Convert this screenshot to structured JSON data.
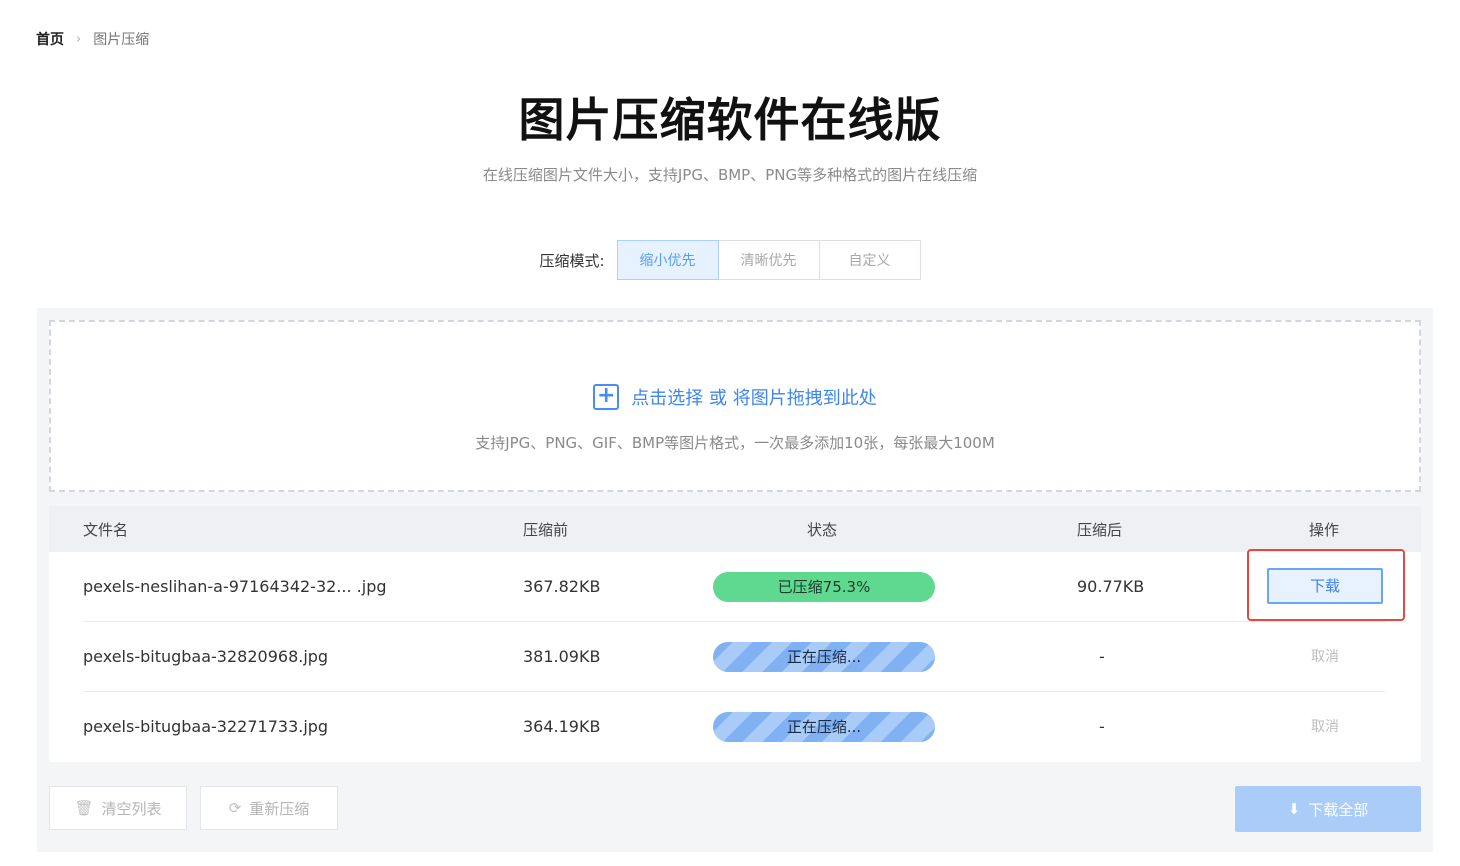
{
  "breadcrumb": {
    "home": "首页",
    "separator": "›",
    "current": "图片压缩"
  },
  "header": {
    "title": "图片压缩软件在线版",
    "subtitle": "在线压缩图片文件大小，支持JPG、BMP、PNG等多种格式的图片在线压缩"
  },
  "mode": {
    "label": "压缩模式:",
    "options": [
      "缩小优先",
      "清晰优先",
      "自定义"
    ],
    "selected": "缩小优先"
  },
  "upload": {
    "icon": "plus-icon",
    "action_text": "点击选择 或 将图片拖拽到此处",
    "hint": "支持JPG、PNG、GIF、BMP等图片格式，一次最多添加10张，每张最大100M"
  },
  "table": {
    "headers": {
      "name": "文件名",
      "before": "压缩前",
      "status": "状态",
      "after": "压缩后",
      "action": "操作"
    },
    "rows": [
      {
        "name": "pexels-neslihan-a-97164342-32... .jpg",
        "before": "367.82KB",
        "status": "已压缩75.3%",
        "after": "90.77KB",
        "action": "下载"
      },
      {
        "name": "pexels-bitugbaa-32820968.jpg",
        "before": "381.09KB",
        "status": "正在压缩...",
        "after": "-",
        "action": "取消"
      },
      {
        "name": "pexels-bitugbaa-32271733.jpg",
        "before": "364.19KB",
        "status": "正在压缩...",
        "after": "-",
        "action": "取消"
      }
    ]
  },
  "footer": {
    "clear_label": "清空列表",
    "recompress_label": "重新压缩",
    "download_all_label": "下载全部"
  },
  "colors": {
    "accent": "#3d86ef",
    "done": "#5fd98f",
    "highlight": "#e2493f"
  }
}
